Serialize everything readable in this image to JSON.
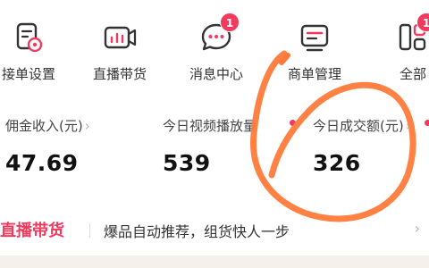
{
  "nav": {
    "items": [
      {
        "label": "接单设置",
        "icon": "order-settings-icon"
      },
      {
        "label": "直播带货",
        "icon": "live-camera-icon"
      },
      {
        "label": "消息中心",
        "icon": "message-bubble-icon",
        "badge": "1"
      },
      {
        "label": "商单管理",
        "icon": "order-manage-icon"
      },
      {
        "label": "全部",
        "icon": "all-grid-icon",
        "badge": "1"
      }
    ]
  },
  "stats": [
    {
      "label": "佣金收入(元)",
      "value": "47.69"
    },
    {
      "label": "今日视频播放量",
      "value": "539"
    },
    {
      "label": "今日成交额(元)",
      "value": "326"
    }
  ],
  "promo": {
    "tag": "直播带货",
    "text": "爆品自动推荐，组货快人一步"
  },
  "colors": {
    "accent": "#f23a5e",
    "annotation": "#ff7a3a"
  }
}
